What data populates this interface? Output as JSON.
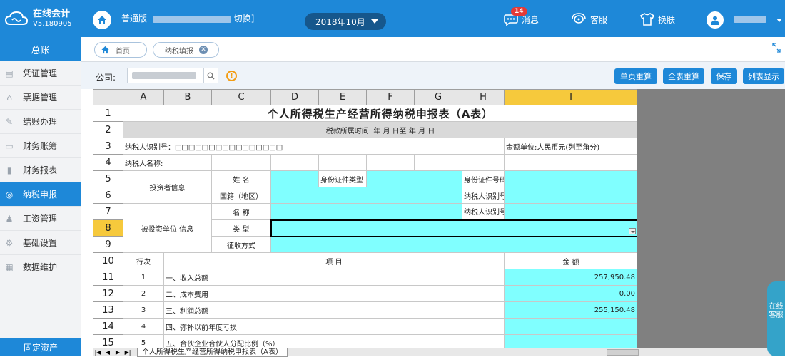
{
  "app": {
    "name": "在线会计",
    "version": "V5.180905"
  },
  "header": {
    "edition": "普通版",
    "switch_label": "切换]",
    "month": "2018年10月",
    "messages_label": "消息",
    "messages_count": "14",
    "service_label": "客服",
    "skin_label": "换肤"
  },
  "sidebar": {
    "head": "总账",
    "items": [
      {
        "label": "凭证管理",
        "icon": "voucher-icon"
      },
      {
        "label": "票据管理",
        "icon": "bill-icon"
      },
      {
        "label": "结账办理",
        "icon": "pencil-icon"
      },
      {
        "label": "财务账簿",
        "icon": "ledger-icon"
      },
      {
        "label": "财务报表",
        "icon": "bar-chart-icon"
      },
      {
        "label": "纳税申报",
        "icon": "tax-icon"
      },
      {
        "label": "工资管理",
        "icon": "salary-icon"
      },
      {
        "label": "基础设置",
        "icon": "settings-icon"
      },
      {
        "label": "数据维护",
        "icon": "database-icon"
      }
    ],
    "active_index": 5,
    "footer": "固定资产"
  },
  "tabs": [
    {
      "label": "首页"
    },
    {
      "label": "纳税填报"
    }
  ],
  "toolbar": {
    "company_label": "公司:",
    "buttons": [
      "单页重算",
      "全表重算",
      "保存",
      "列表显示"
    ]
  },
  "sheet": {
    "columns": [
      "A",
      "B",
      "C",
      "D",
      "E",
      "F",
      "G",
      "H",
      "I"
    ],
    "selected_column": "I",
    "selected_row": "8",
    "rows": [
      "1",
      "2",
      "3",
      "4",
      "5",
      "6",
      "7",
      "8",
      "9",
      "10",
      "11",
      "12",
      "13",
      "14",
      "15"
    ],
    "title": "个人所得税生产经营所得纳税申报表（A表）",
    "period_line": "税款所属时间:      年    月    日至    年    月    日",
    "taxpayer_id": "纳税人识别号：□□□□□□□□□□□□□□□□",
    "amount_unit": "金额单位:人民币元(列至角分)",
    "taxpayer_name": "纳税人名称:",
    "investor_info": "投资者信息",
    "name_label": "姓   名",
    "id_type_label": "身份证件类型",
    "id_no_label": "身份证件号码",
    "country_label": "国籍（地区）",
    "taxpayer_id_label": "纳税人识别号",
    "invested_unit_info": "被投资单位   信息",
    "unit_name_label": "名   称",
    "type_label": "类   型",
    "collection_label": "征收方式",
    "line_no_header": "行次",
    "item_header": "项   目",
    "amount_header": "金   额",
    "lines": [
      {
        "no": "1",
        "item": "一、收入总额",
        "amount": "257,950.48"
      },
      {
        "no": "2",
        "item": "二、成本费用",
        "amount": "0.00"
      },
      {
        "no": "3",
        "item": "三、利润总额",
        "amount": "255,150.48"
      },
      {
        "no": "4",
        "item": "四、弥补以前年度亏损",
        "amount": ""
      },
      {
        "no": "5",
        "item": "五、合伙企业合伙人分配比例（%）",
        "amount": ""
      }
    ],
    "sheet_tab": "个人所得税生产经营所得纳税申报表（A表）"
  },
  "floater": {
    "label": "在线客服"
  },
  "colors": {
    "brand": "#1e88d8",
    "input_cell": "#80ffff",
    "selected_header": "#f6c93c"
  }
}
